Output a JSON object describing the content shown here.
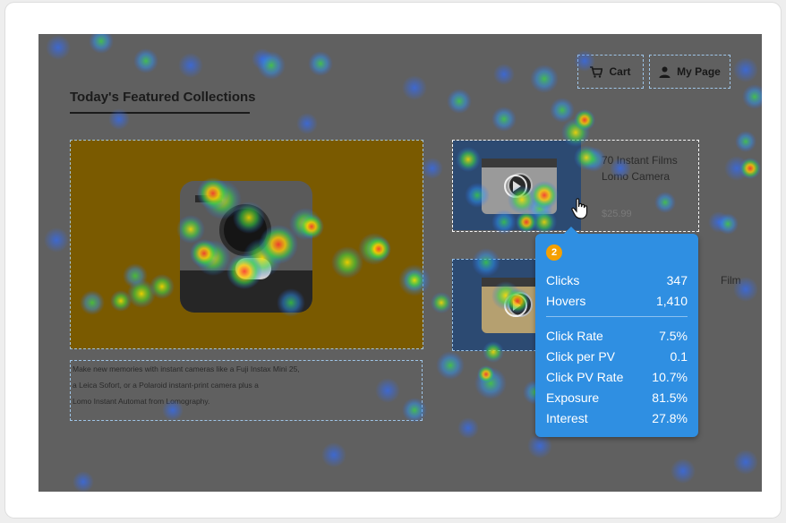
{
  "page": {
    "title": "Today's Featured Collections"
  },
  "header": {
    "cart_label": "Cart",
    "mypage_label": "My Page",
    "cart_icon": "cart-icon",
    "user_icon": "user-icon"
  },
  "hero": {
    "description_lines": [
      "Make new memories with instant cameras like a Fuji Instax Mini 25,",
      "a Leica Sofort, or a Polaroid instant-print camera plus a",
      "Lomo Instant Automat from Lomography."
    ]
  },
  "products": [
    {
      "title_line1": "70 Instant Films",
      "title_line2": "Lomo Camera",
      "price": "$25.99"
    },
    {
      "title_line1": "Film"
    }
  ],
  "tooltip": {
    "badge": "2",
    "metrics_top": [
      {
        "label": "Clicks",
        "value": "347"
      },
      {
        "label": "Hovers",
        "value": "1,410"
      }
    ],
    "metrics_bottom": [
      {
        "label": "Click Rate",
        "value": "7.5%"
      },
      {
        "label": "Click per PV",
        "value": "0.1"
      },
      {
        "label": "Click PV Rate",
        "value": "10.7%"
      },
      {
        "label": "Exposure",
        "value": "81.5%"
      },
      {
        "label": "Interest",
        "value": "27.8%"
      }
    ]
  },
  "colors": {
    "overlay": "#606060",
    "tooltip": "#2f8fe2",
    "badge": "#f5a000",
    "hero_bg": "#7a5a00"
  }
}
